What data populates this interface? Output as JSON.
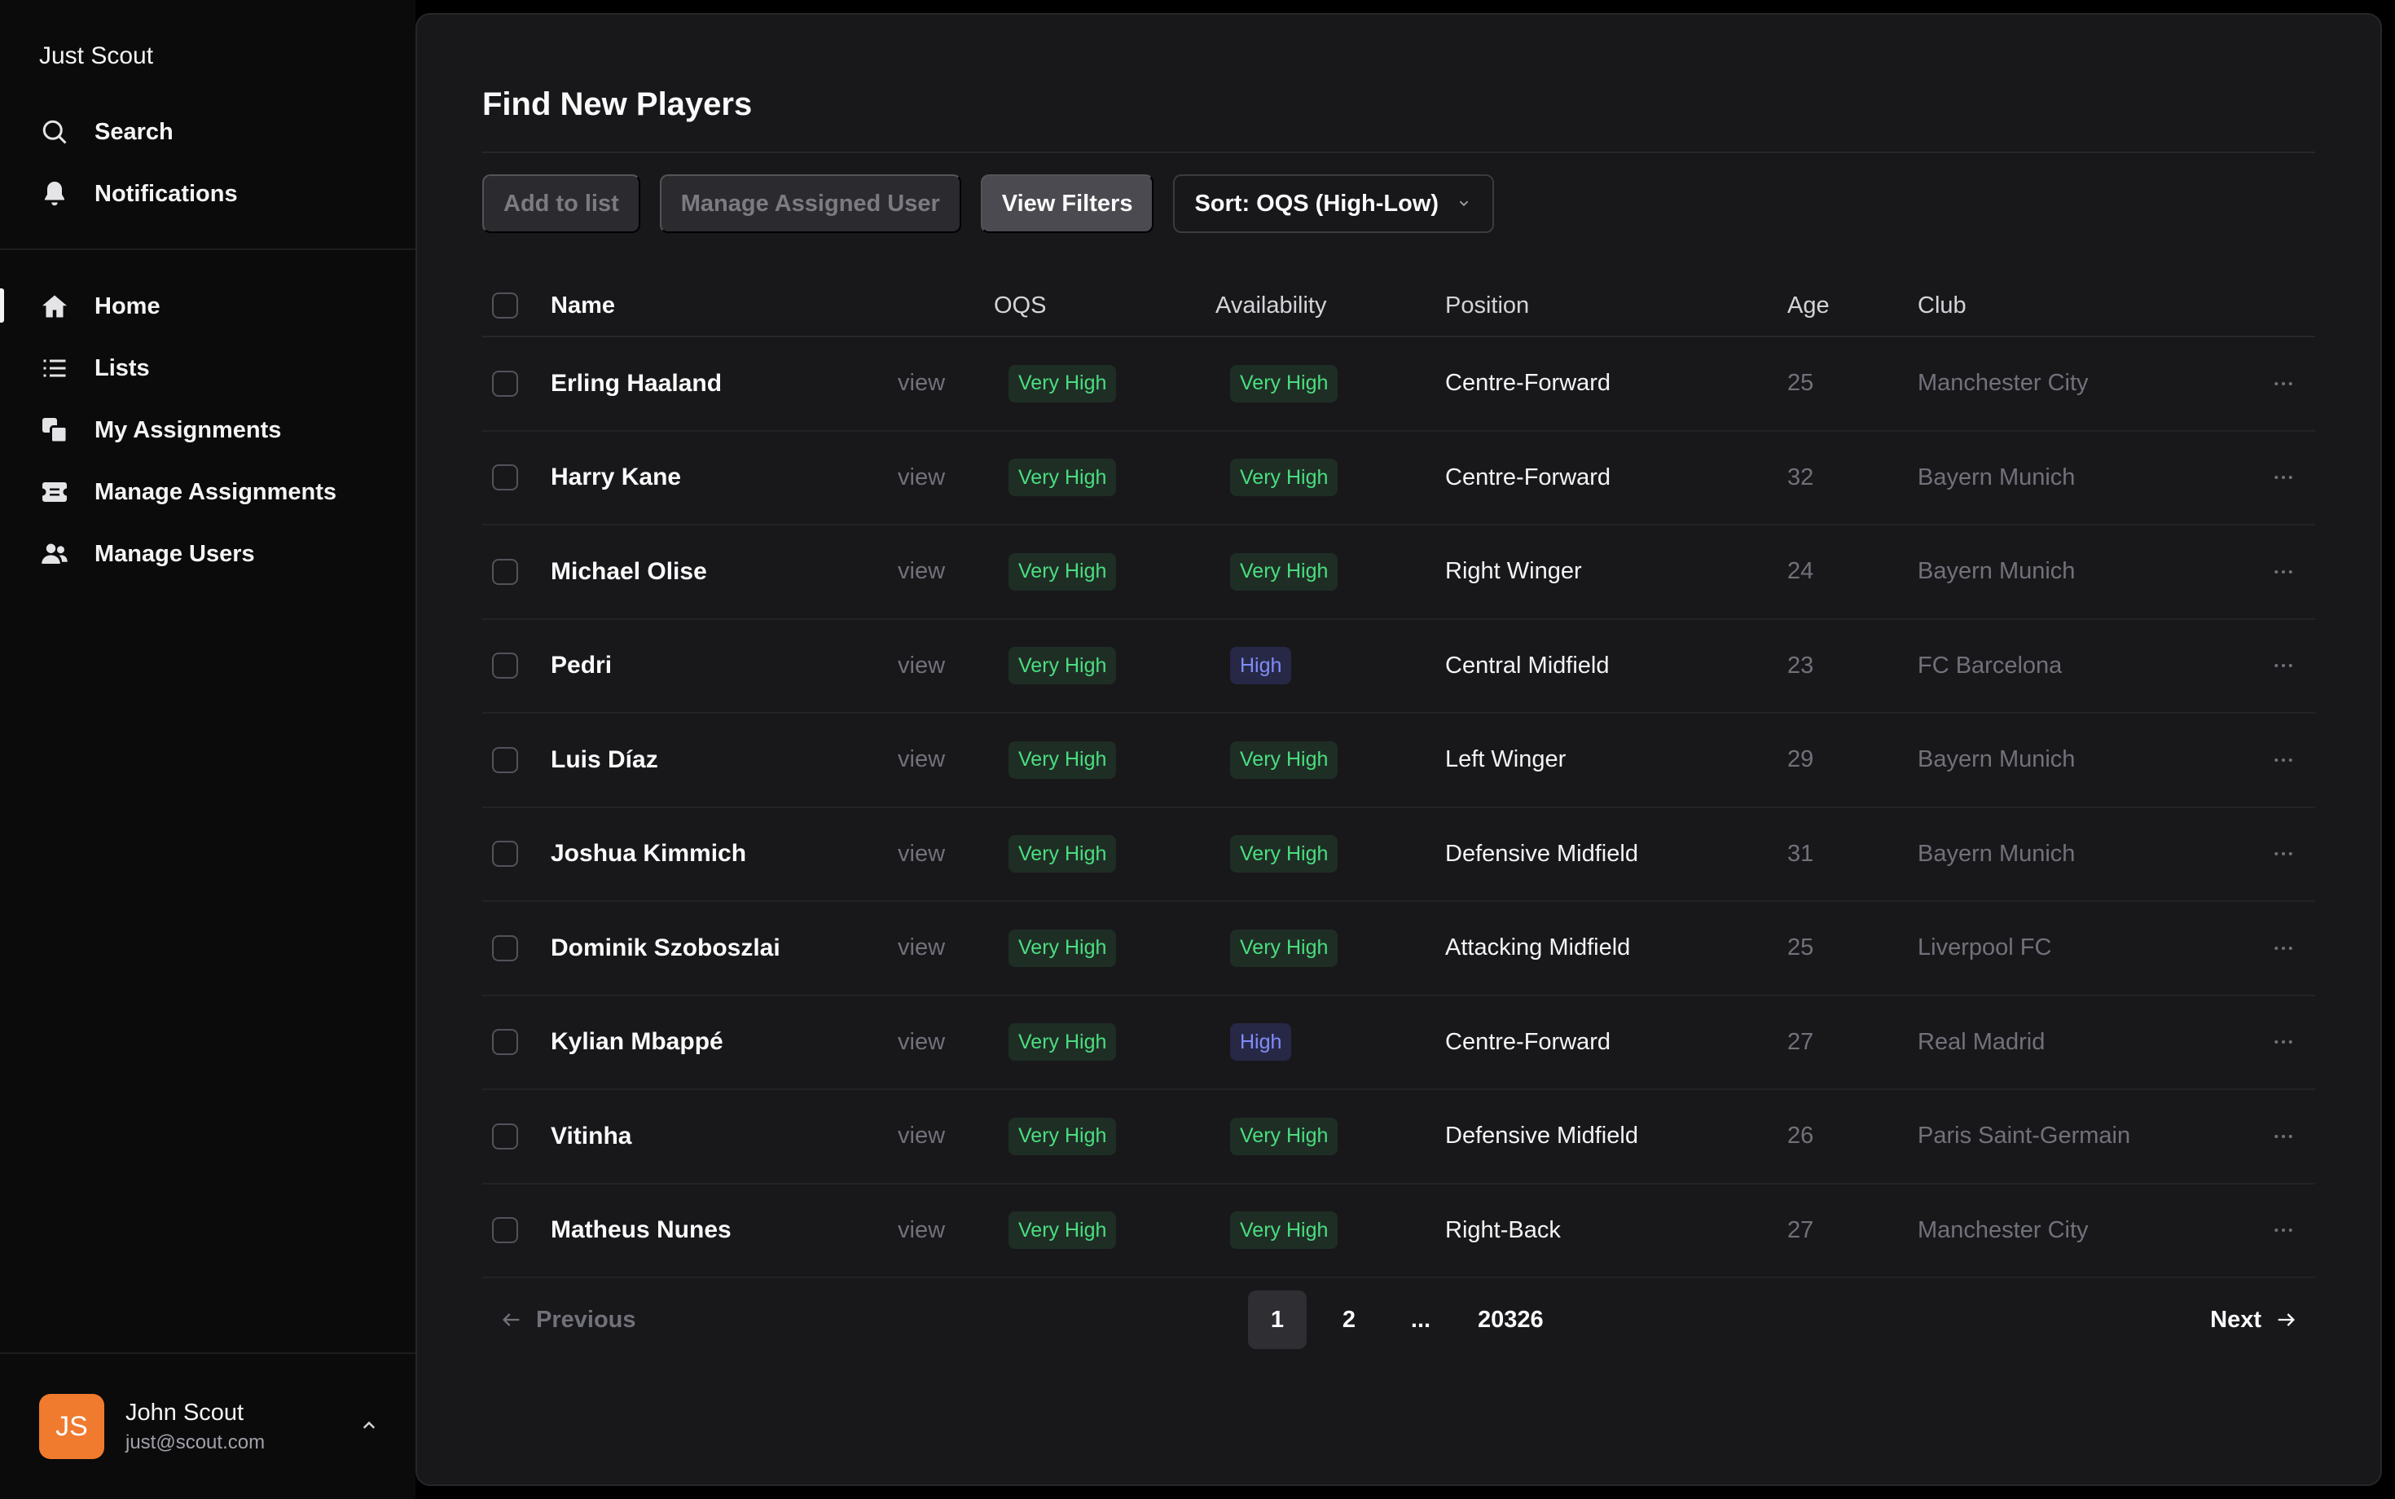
{
  "app": {
    "brand": "Just Scout"
  },
  "sidebar": {
    "top_items": [
      {
        "label": "Search",
        "icon": "search-icon"
      },
      {
        "label": "Notifications",
        "icon": "bell-icon"
      }
    ],
    "main_items": [
      {
        "label": "Home",
        "icon": "home-icon",
        "active": true
      },
      {
        "label": "Lists",
        "icon": "list-icon"
      },
      {
        "label": "My Assignments",
        "icon": "copy-icon"
      },
      {
        "label": "Manage Assignments",
        "icon": "ticket-icon"
      },
      {
        "label": "Manage Users",
        "icon": "users-icon"
      }
    ],
    "user": {
      "initials": "JS",
      "name": "John Scout",
      "email": "just@scout.com"
    }
  },
  "main": {
    "title": "Find New Players",
    "toolbar": {
      "add_to_list": "Add to list",
      "manage_assigned_user": "Manage Assigned User",
      "view_filters": "View Filters",
      "sort": "Sort: OQS (High-Low)"
    },
    "table": {
      "headers": {
        "name": "Name",
        "oqs": "OQS",
        "availability": "Availability",
        "position": "Position",
        "age": "Age",
        "club": "Club"
      },
      "view_label": "view",
      "rows": [
        {
          "name": "Erling Haaland",
          "oqs": "Very High",
          "availability": "Very High",
          "position": "Centre-Forward",
          "age": "25",
          "club": "Manchester City"
        },
        {
          "name": "Harry Kane",
          "oqs": "Very High",
          "availability": "Very High",
          "position": "Centre-Forward",
          "age": "32",
          "club": "Bayern Munich"
        },
        {
          "name": "Michael Olise",
          "oqs": "Very High",
          "availability": "Very High",
          "position": "Right Winger",
          "age": "24",
          "club": "Bayern Munich"
        },
        {
          "name": "Pedri",
          "oqs": "Very High",
          "availability": "High",
          "position": "Central Midfield",
          "age": "23",
          "club": "FC Barcelona"
        },
        {
          "name": "Luis Díaz",
          "oqs": "Very High",
          "availability": "Very High",
          "position": "Left Winger",
          "age": "29",
          "club": "Bayern Munich"
        },
        {
          "name": "Joshua Kimmich",
          "oqs": "Very High",
          "availability": "Very High",
          "position": "Defensive Midfield",
          "age": "31",
          "club": "Bayern Munich"
        },
        {
          "name": "Dominik Szoboszlai",
          "oqs": "Very High",
          "availability": "Very High",
          "position": "Attacking Midfield",
          "age": "25",
          "club": "Liverpool FC"
        },
        {
          "name": "Kylian Mbappé",
          "oqs": "Very High",
          "availability": "High",
          "position": "Centre-Forward",
          "age": "27",
          "club": "Real Madrid"
        },
        {
          "name": "Vitinha",
          "oqs": "Very High",
          "availability": "Very High",
          "position": "Defensive Midfield",
          "age": "26",
          "club": "Paris Saint-Germain"
        },
        {
          "name": "Matheus Nunes",
          "oqs": "Very High",
          "availability": "Very High",
          "position": "Right-Back",
          "age": "27",
          "club": "Manchester City"
        }
      ]
    },
    "pagination": {
      "previous": "Previous",
      "next": "Next",
      "pages": [
        {
          "label": "1",
          "active": true
        },
        {
          "label": "2"
        },
        {
          "label": "...",
          "ellipsis": true
        },
        {
          "label": "20326"
        }
      ]
    }
  },
  "colors": {
    "badge_very_high_text": "#4ade80",
    "badge_very_high_bg": "#1f2e25",
    "badge_high_text": "#818cf8",
    "badge_high_bg": "#262846",
    "avatar_bg": "#f07a2e"
  }
}
